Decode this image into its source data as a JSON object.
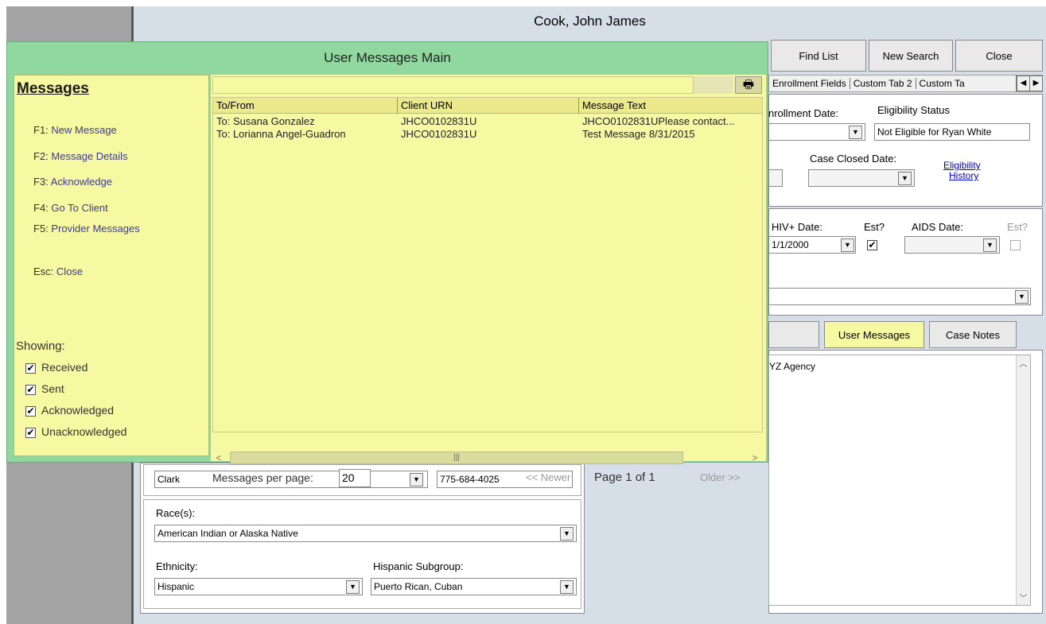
{
  "client": {
    "name": "Cook, John James"
  },
  "toolbar": {
    "find_list": "Find List",
    "new_search": "New Search",
    "close": "Close"
  },
  "tabs": {
    "items": [
      "Enrollment Fields",
      "Custom Tab 2",
      "Custom Ta"
    ]
  },
  "enrollment": {
    "enrollment_date_label": "nrollment Date:",
    "eligibility_status_label": "Eligibility Status",
    "eligibility_status_value": "Not Eligible for Ryan White",
    "case_closed_date_label": "Case Closed Date:",
    "eligibility_history_link_1": "Eligibility",
    "eligibility_history_link_2": "History"
  },
  "hiv": {
    "hiv_date_label": "HIV+ Date:",
    "hiv_date_value": "1/1/2000",
    "est_label": "Est?",
    "aids_date_label": "AIDS Date:",
    "aids_est_label": "Est?"
  },
  "notes_tabs": {
    "user_messages": "User Messages",
    "case_notes": "Case Notes"
  },
  "notes": {
    "text": "YZ Agency"
  },
  "demographics": {
    "county": "Clark",
    "phone": "775-684-4025",
    "race_label": "Race(s):",
    "race_value": "American Indian or Alaska Native",
    "ethnicity_label": "Ethnicity:",
    "ethnicity_value": "Hispanic",
    "hispanic_subgroup_label": "Hispanic Subgroup:",
    "hispanic_subgroup_value": "Puerto Rican, Cuban"
  },
  "modal": {
    "title": "User Messages Main",
    "menu_heading": "Messages",
    "menu": [
      {
        "key": "F1:",
        "label": "New Message"
      },
      {
        "key": "F2:",
        "label": "Message Details"
      },
      {
        "key": "F3:",
        "label": "Acknowledge"
      },
      {
        "key": "F4:",
        "label": "Go To Client"
      },
      {
        "key": "F5:",
        "label": "Provider Messages"
      },
      {
        "key": "Esc:",
        "label": "Close"
      }
    ],
    "showing_label": "Showing:",
    "filters": [
      {
        "label": "Received",
        "checked": true
      },
      {
        "label": "Sent",
        "checked": true
      },
      {
        "label": "Acknowledged",
        "checked": true
      },
      {
        "label": "Unacknowledged",
        "checked": true
      }
    ],
    "columns": [
      "To/From",
      "Client URN",
      "Message Text"
    ],
    "rows": [
      [
        "To: Susana Gonzalez",
        "JHCO0102831U",
        "JHCO0102831UPlease contact..."
      ],
      [
        "To: Lorianna Angel-Guadron",
        "JHCO0102831U",
        "Test Message 8/31/2015"
      ]
    ],
    "messages_per_page_label": "Messages per page:",
    "messages_per_page_value": "20",
    "newer_label": "<< Newer",
    "page_label": "Page 1 of 1",
    "older_label": "Older >>"
  },
  "colors": {
    "modal_bg": "#90d8a0",
    "pane_bg": "#f7f8a2",
    "selected_tab": "#f7f8a2"
  }
}
